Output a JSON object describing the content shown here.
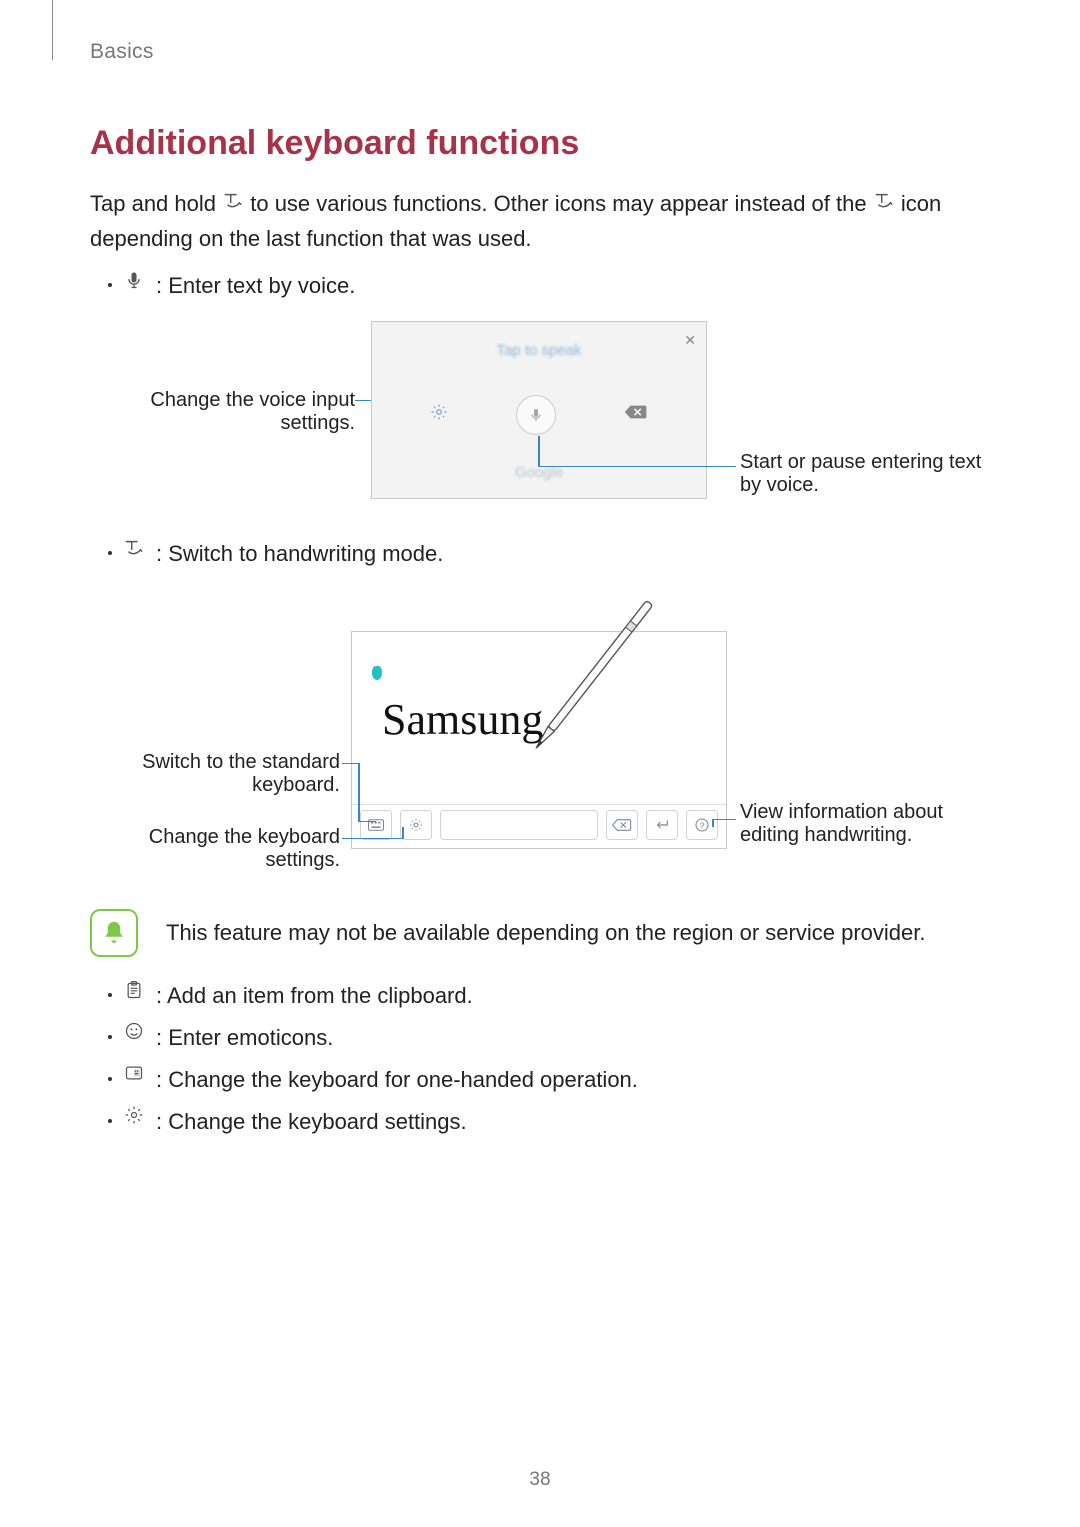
{
  "breadcrumb": "Basics",
  "section_heading": "Additional keyboard functions",
  "intro_part1": "Tap and hold ",
  "intro_part2": " to use various functions. Other icons may appear instead of the ",
  "intro_part3": " icon depending on the last function that was used.",
  "bullets_top": [
    {
      "icon": "mic-icon",
      "text": ": Enter text by voice."
    }
  ],
  "fig1": {
    "title_blurred": "Tap to speak",
    "brand_blurred": "Google",
    "callout_left": "Change the voice input settings.",
    "callout_right": "Start or pause entering text by voice."
  },
  "bullets_mid": [
    {
      "icon": "pen-t-icon",
      "text": ": Switch to handwriting mode."
    }
  ],
  "fig2": {
    "handwriting_sample": "Samsung",
    "callout_left_a": "Switch to the standard keyboard.",
    "callout_left_b": "Change the keyboard settings.",
    "callout_right": "View information about editing handwriting."
  },
  "note_text": "This feature may not be available depending on the region or service provider.",
  "bullets_bottom": [
    {
      "icon": "clipboard-icon",
      "text": ": Add an item from the clipboard."
    },
    {
      "icon": "smiley-icon",
      "text": ": Enter emoticons."
    },
    {
      "icon": "onehand-kb-icon",
      "text": ": Change the keyboard for one-handed operation."
    },
    {
      "icon": "gear-icon",
      "text": ": Change the keyboard settings."
    }
  ],
  "page_number": "38"
}
